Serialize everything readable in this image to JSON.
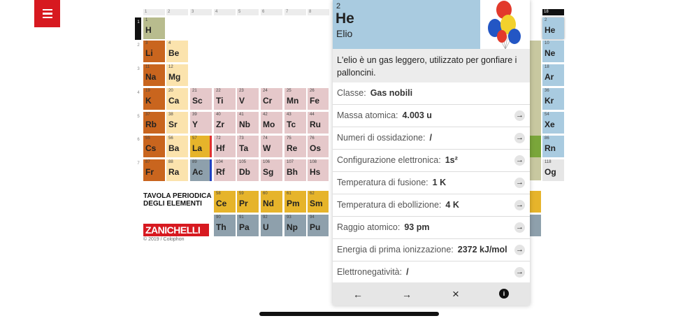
{
  "menu": {
    "icon": "hamburger-icon"
  },
  "table": {
    "groups": [
      "1",
      "2",
      "3",
      "4",
      "5",
      "6",
      "7",
      "8",
      "18"
    ],
    "periods": [
      "1",
      "2",
      "3",
      "4",
      "5",
      "6",
      "7"
    ],
    "title_line1": "TAVOLA PERIODICA",
    "title_line2": "DEGLI ELEMENTI",
    "brand": "ZANICHELLI",
    "colophon": "© 2019 / Colophon",
    "elements": [
      {
        "n": "1",
        "s": "H",
        "c": "#b8bc8e"
      },
      {
        "n": "3",
        "s": "Li",
        "c": "#c9651e"
      },
      {
        "n": "4",
        "s": "Be",
        "c": "#fbe3ad"
      },
      {
        "n": "11",
        "s": "Na",
        "c": "#c9651e"
      },
      {
        "n": "12",
        "s": "Mg",
        "c": "#fbe3ad"
      },
      {
        "n": "19",
        "s": "K",
        "c": "#c9651e"
      },
      {
        "n": "20",
        "s": "Ca",
        "c": "#fbe3ad"
      },
      {
        "n": "21",
        "s": "Sc",
        "c": "#e5c8ca"
      },
      {
        "n": "22",
        "s": "Ti",
        "c": "#e5c8ca"
      },
      {
        "n": "23",
        "s": "V",
        "c": "#e5c8ca"
      },
      {
        "n": "24",
        "s": "Cr",
        "c": "#e5c8ca"
      },
      {
        "n": "25",
        "s": "Mn",
        "c": "#e5c8ca"
      },
      {
        "n": "26",
        "s": "Fe",
        "c": "#e5c8ca"
      },
      {
        "n": "37",
        "s": "Rb",
        "c": "#c9651e"
      },
      {
        "n": "38",
        "s": "Sr",
        "c": "#fbe3ad"
      },
      {
        "n": "39",
        "s": "Y",
        "c": "#e5c8ca"
      },
      {
        "n": "40",
        "s": "Zr",
        "c": "#e5c8ca"
      },
      {
        "n": "41",
        "s": "Nb",
        "c": "#e5c8ca"
      },
      {
        "n": "42",
        "s": "Mo",
        "c": "#e5c8ca"
      },
      {
        "n": "43",
        "s": "Tc",
        "c": "#e5c8ca"
      },
      {
        "n": "44",
        "s": "Ru",
        "c": "#e5c8ca"
      },
      {
        "n": "55",
        "s": "Cs",
        "c": "#c9651e"
      },
      {
        "n": "56",
        "s": "Ba",
        "c": "#fbe3ad"
      },
      {
        "n": "57",
        "s": "La",
        "c": "#e6b42b"
      },
      {
        "n": "72",
        "s": "Hf",
        "c": "#e5c8ca"
      },
      {
        "n": "73",
        "s": "Ta",
        "c": "#e5c8ca"
      },
      {
        "n": "74",
        "s": "W",
        "c": "#e5c8ca"
      },
      {
        "n": "75",
        "s": "Re",
        "c": "#e5c8ca"
      },
      {
        "n": "76",
        "s": "Os",
        "c": "#e5c8ca"
      },
      {
        "n": "87",
        "s": "Fr",
        "c": "#c9651e"
      },
      {
        "n": "88",
        "s": "Ra",
        "c": "#fbe3ad"
      },
      {
        "n": "89",
        "s": "Ac",
        "c": "#8ea0ac"
      },
      {
        "n": "104",
        "s": "Rf",
        "c": "#e5c8ca"
      },
      {
        "n": "105",
        "s": "Db",
        "c": "#e5c8ca"
      },
      {
        "n": "106",
        "s": "Sg",
        "c": "#e5c8ca"
      },
      {
        "n": "107",
        "s": "Bh",
        "c": "#e5c8ca"
      },
      {
        "n": "108",
        "s": "Hs",
        "c": "#e5c8ca"
      },
      {
        "n": "58",
        "s": "Ce",
        "c": "#e6b42b"
      },
      {
        "n": "59",
        "s": "Pr",
        "c": "#e6b42b"
      },
      {
        "n": "60",
        "s": "Nd",
        "c": "#e6b42b"
      },
      {
        "n": "61",
        "s": "Pm",
        "c": "#e6b42b"
      },
      {
        "n": "62",
        "s": "Sm",
        "c": "#e6b42b"
      },
      {
        "n": "90",
        "s": "Th",
        "c": "#8ea0ac"
      },
      {
        "n": "91",
        "s": "Pa",
        "c": "#8ea0ac"
      },
      {
        "n": "92",
        "s": "U",
        "c": "#8ea0ac"
      },
      {
        "n": "93",
        "s": "Np",
        "c": "#8ea0ac"
      },
      {
        "n": "94",
        "s": "Pu",
        "c": "#8ea0ac"
      },
      {
        "n": "2",
        "s": "He",
        "c": "#a9cbe0"
      },
      {
        "n": "10",
        "s": "Ne",
        "c": "#a9cbe0"
      },
      {
        "n": "18",
        "s": "Ar",
        "c": "#a9cbe0"
      },
      {
        "n": "36",
        "s": "Kr",
        "c": "#a9cbe0"
      },
      {
        "n": "54",
        "s": "Xe",
        "c": "#a9cbe0"
      },
      {
        "n": "86",
        "s": "Rn",
        "c": "#a9cbe0"
      },
      {
        "n": "118",
        "s": "Og",
        "c": "#e6e6e6"
      }
    ]
  },
  "panel": {
    "number": "2",
    "symbol": "He",
    "name": "Elio",
    "image": "balloons",
    "description": "L'elio è un gas leggero, utilizzato per gonfiare i palloncini.",
    "rows": [
      {
        "label": "Classe:",
        "value": "Gas nobili",
        "arrow": false
      },
      {
        "label": "Massa atomica:",
        "value": "4.003 u",
        "arrow": true
      },
      {
        "label": "Numeri di ossidazione:",
        "value": "/",
        "arrow": true
      },
      {
        "label": "Configurazione elettronica:",
        "value": "1s²",
        "arrow": true
      },
      {
        "label": "Temperatura di fusione:",
        "value": "1 K",
        "arrow": true
      },
      {
        "label": "Temperatura di ebollizione:",
        "value": "4 K",
        "arrow": true
      },
      {
        "label": "Raggio atomico:",
        "value": "93 pm",
        "arrow": true
      },
      {
        "label": "Energia di prima ionizzazione:",
        "value": "2372 kJ/mol",
        "arrow": true
      },
      {
        "label": "Elettronegatività:",
        "value": "/",
        "arrow": true
      }
    ],
    "footer": {
      "back": "←",
      "forward": "→",
      "close": "×",
      "info": "i"
    }
  },
  "colors": {
    "accent": "#d71920",
    "noble_gas": "#a9cbe0"
  }
}
